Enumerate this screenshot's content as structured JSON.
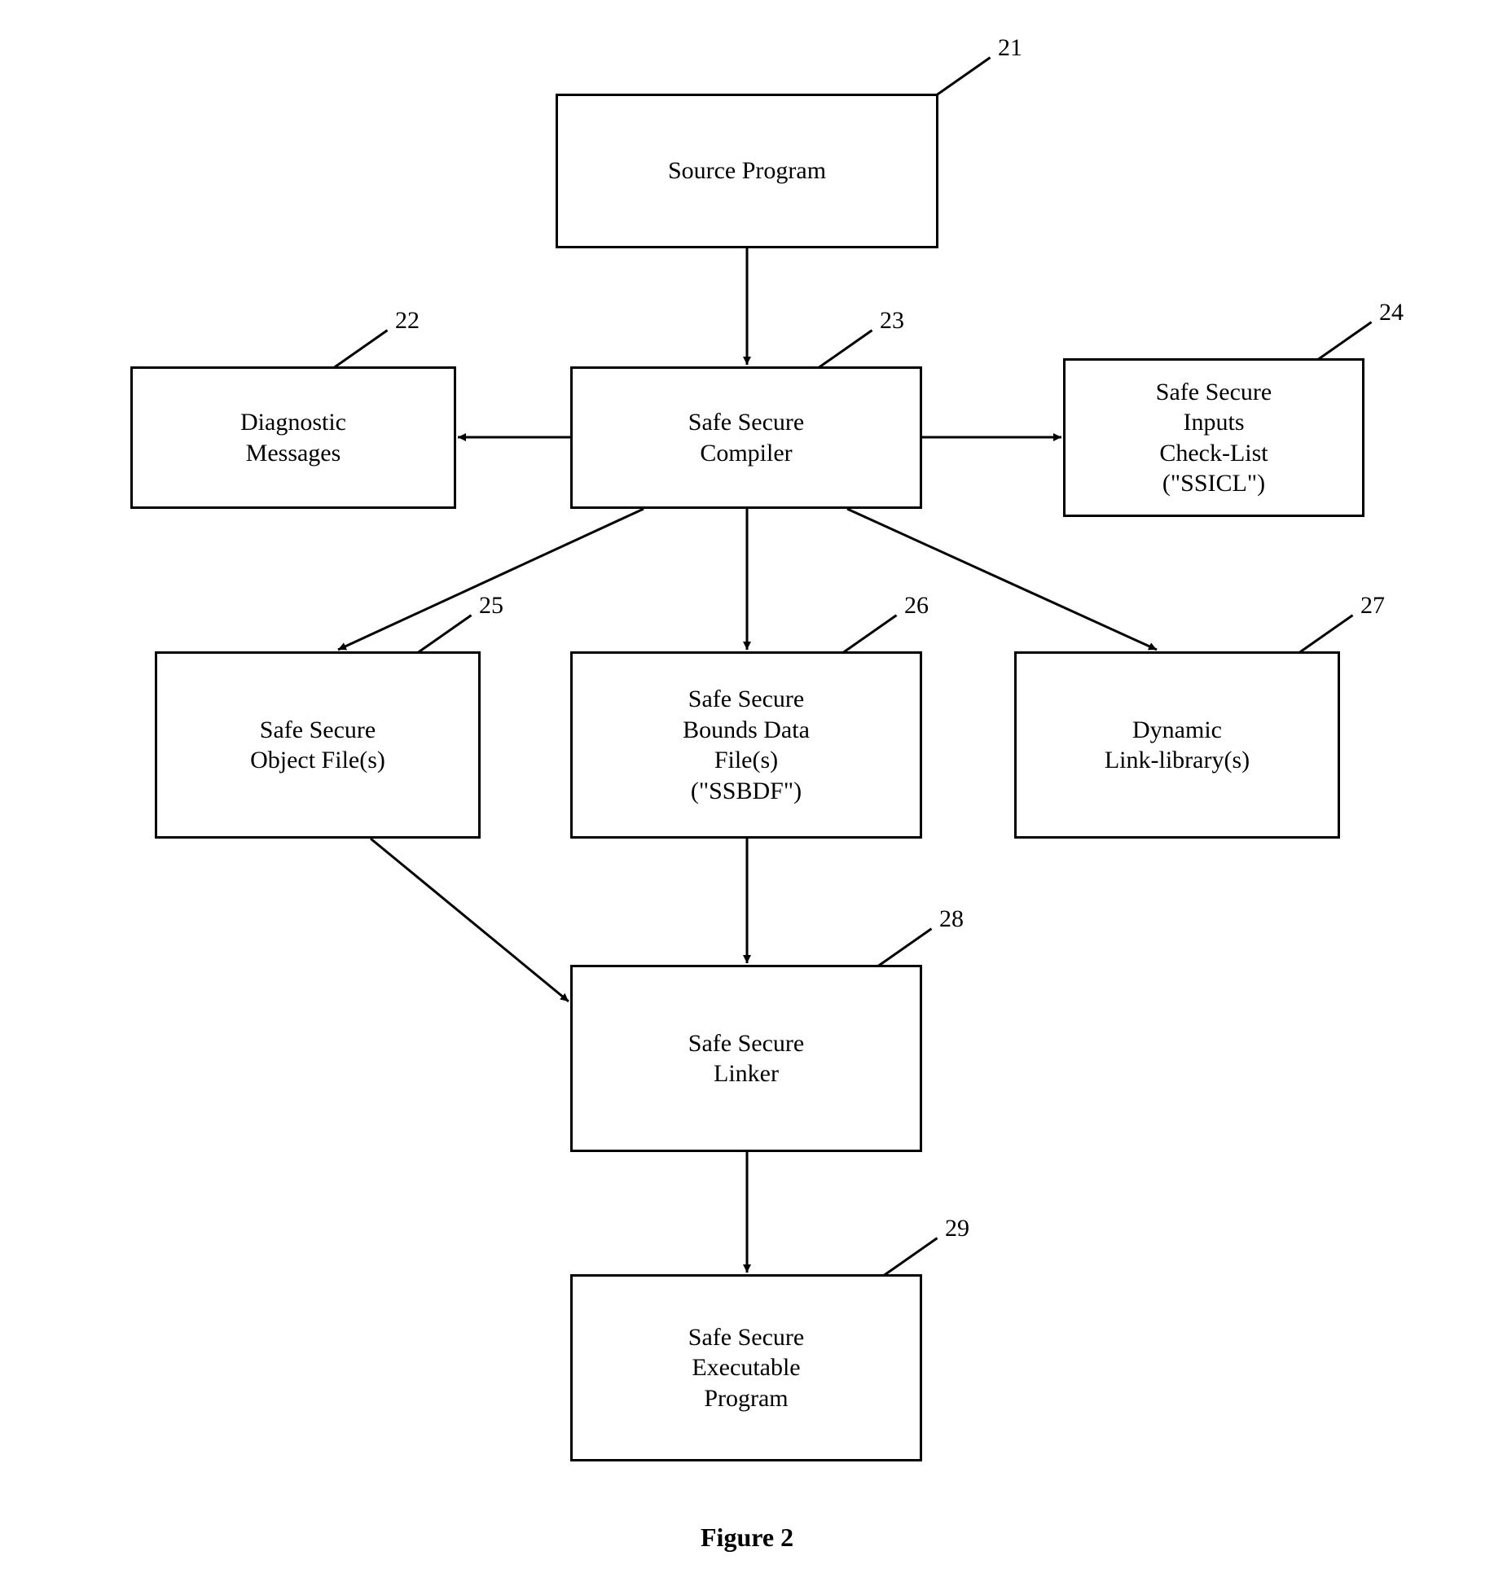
{
  "boxes": {
    "b21": "Source Program",
    "b22": "Diagnostic\nMessages",
    "b23": "Safe Secure\nCompiler",
    "b24": "Safe Secure\nInputs\nCheck-List\n(\"SSICL\")",
    "b25": "Safe Secure\nObject File(s)",
    "b26": "Safe Secure\nBounds Data\nFile(s)\n(\"SSBDF\")",
    "b27": "Dynamic\nLink-library(s)",
    "b28": "Safe Secure\nLinker",
    "b29": "Safe Secure\nExecutable\nProgram"
  },
  "refs": {
    "r21": "21",
    "r22": "22",
    "r23": "23",
    "r24": "24",
    "r25": "25",
    "r26": "26",
    "r27": "27",
    "r28": "28",
    "r29": "29"
  },
  "caption": "Figure 2"
}
